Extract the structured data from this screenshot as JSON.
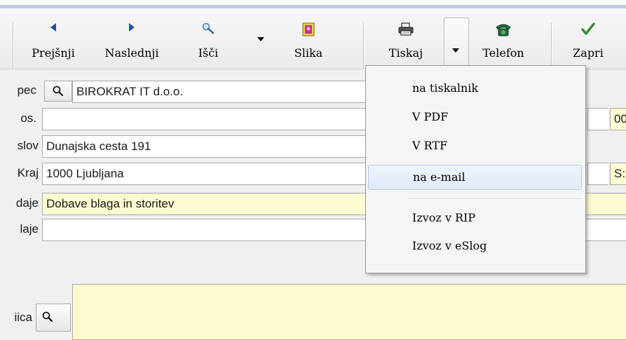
{
  "toolbar": {
    "buttons": [
      {
        "label": "Prejšnji",
        "icon": "arrow-left-icon"
      },
      {
        "label": "Naslednji",
        "icon": "arrow-right-icon"
      },
      {
        "label": "Išči",
        "icon": "search-icon"
      },
      {
        "label": "Slika",
        "icon": "picture-icon"
      },
      {
        "label": "Tiskaj",
        "icon": "printer-icon"
      },
      {
        "label": "Telefon",
        "icon": "telephone-icon"
      },
      {
        "label": "Zapri",
        "icon": "checkmark-icon"
      }
    ]
  },
  "form": {
    "rows": [
      {
        "label": "pec",
        "value": "BIROKRAT IT d.o.o.",
        "right_value": ""
      },
      {
        "label": "os.",
        "value": "",
        "right_value": "00"
      },
      {
        "label": "slov",
        "value": "Dunajska cesta 191",
        "right_value": ""
      },
      {
        "label": "Kraj",
        "value": "1000 Ljubljana",
        "right_value": "S:"
      },
      {
        "label": "daje",
        "value": "Dobave blaga in storitev",
        "right_value": ""
      },
      {
        "label": "laje",
        "value": "",
        "right_value": ""
      },
      {
        "label": "iica",
        "value": "",
        "right_value": ""
      }
    ]
  },
  "menu": {
    "items": [
      {
        "label": "na tiskalnik"
      },
      {
        "label": "V PDF"
      },
      {
        "label": "V RTF"
      },
      {
        "label": "na e-mail",
        "highlighted": true
      },
      {
        "label": "Izvoz v RIP"
      },
      {
        "label": "Izvoz v eSlog"
      }
    ]
  },
  "colors": {
    "yellow_field": "#fffbd1",
    "menu_highlight": "#dfeaf8",
    "arrow_blue": "#1d4fa7",
    "check_green": "#2e8b2e",
    "phone_green": "#1f6b3a"
  }
}
